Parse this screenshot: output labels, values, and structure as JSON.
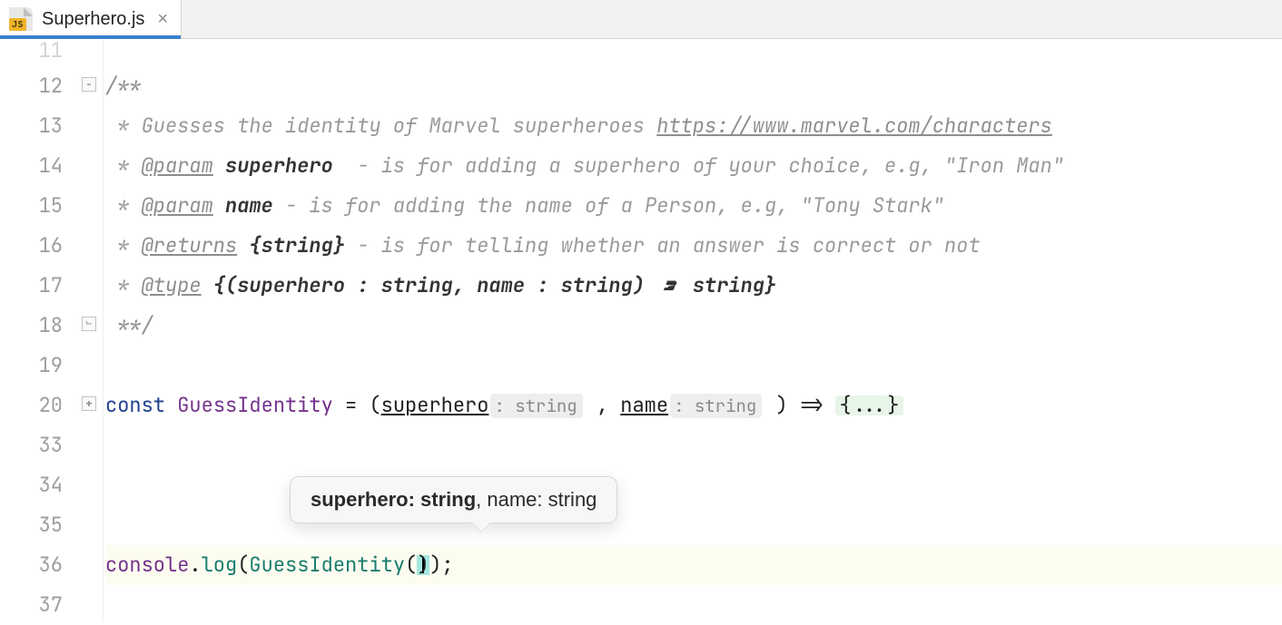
{
  "tab": {
    "filename": "Superhero.js",
    "icon_badge": "JS"
  },
  "gutter_numbers": [
    "11",
    "12",
    "13",
    "14",
    "15",
    "16",
    "17",
    "18",
    "19",
    "20",
    "33",
    "34",
    "35",
    "36",
    "37"
  ],
  "code": {
    "l12": "/**",
    "l13_pre": " * Guesses the identity of Marvel superheroes ",
    "l13_link": "https://www.marvel.com/characters",
    "l14_pre": " * ",
    "l14_tag": "@param",
    "l14_name": " superhero",
    "l14_rest": "  - is for adding a superhero of your choice, e.g, \"Iron Man\"",
    "l15_pre": " * ",
    "l15_tag": "@param",
    "l15_name": " name",
    "l15_rest": " - is for adding the name of a Person, e.g, \"Tony Stark\"",
    "l16_pre": " * ",
    "l16_tag": "@returns",
    "l16_type": " {string}",
    "l16_rest": " - is for telling whether an answer is correct or not",
    "l17_pre": " * ",
    "l17_tag": "@type",
    "l17_rest": " {(superhero : string, name : string) => string}",
    "l18": " **/",
    "l20_kw": "const",
    "l20_sp1": " ",
    "l20_id": "GuessIdentity",
    "l20_sp2": " = (",
    "l20_p1": "superhero",
    "l20_h1": ": string",
    "l20_comma": " , ",
    "l20_p2": "name",
    "l20_h2": ": string",
    "l20_close": " ) => ",
    "l20_body": "{...}",
    "l36_obj": "console",
    "l36_dot": ".",
    "l36_fn": "log",
    "l36_open": "(",
    "l36_call": "GuessIdentity",
    "l36_p_open": "(",
    "l36_p_close": ")",
    "l36_close": ");"
  },
  "tooltip": {
    "current_bold": "superhero: string",
    "rest": ", name: string"
  }
}
